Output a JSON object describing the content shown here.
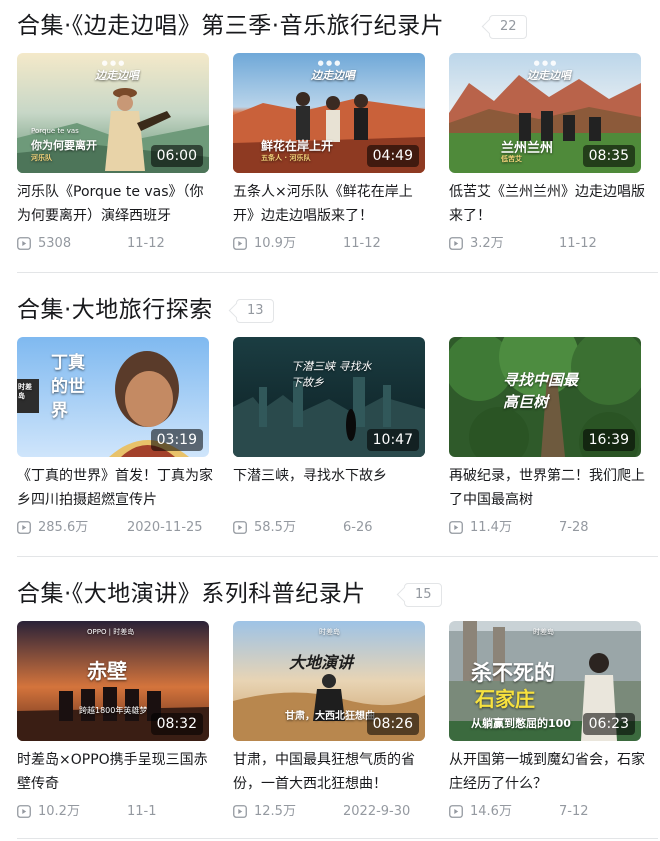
{
  "sections": [
    {
      "title": "合集·《边走边唱》第三季·音乐旅行纪录片",
      "count": "22",
      "cards": [
        {
          "title": "河乐队《Porque te vas》（你为何要离开）演绎西班牙",
          "duration": "06:00",
          "views": "5308",
          "date": "11-12",
          "overlay_main": "你为何要离开",
          "overlay_sub": "河乐队",
          "overlay_top": "Porque te vas",
          "logo": "边走边唱"
        },
        {
          "title": "五条人×河乐队《鲜花在岸上开》边走边唱版来了！",
          "duration": "04:49",
          "views": "10.9万",
          "date": "11-12",
          "overlay_main": "鲜花在岸上开",
          "overlay_sub": "五条人 · 河乐队",
          "logo": "边走边唱"
        },
        {
          "title": "低苦艾《兰州兰州》边走边唱版来了！",
          "duration": "08:35",
          "views": "3.2万",
          "date": "11-12",
          "overlay_main": "兰州兰州",
          "overlay_sub": "低苦艾",
          "logo": "边走边唱"
        }
      ]
    },
    {
      "title": "合集·大地旅行探索",
      "count": "13",
      "cards": [
        {
          "title": "《丁真的世界》首发！丁真为家乡四川拍摄超燃宣传片",
          "duration": "03:19",
          "views": "285.6万",
          "date": "2020-11-25",
          "overlay_main": "丁真的世界",
          "badge": "时差岛"
        },
        {
          "title": "下潜三峡，寻找水下故乡",
          "duration": "10:47",
          "views": "58.5万",
          "date": "6-26",
          "overlay_main": "下潜三峡 寻找水下故乡"
        },
        {
          "title": "再破纪录，世界第二！我们爬上了中国最高树",
          "duration": "16:39",
          "views": "11.4万",
          "date": "7-28",
          "overlay_main": "寻找中国最高巨树"
        }
      ]
    },
    {
      "title": "合集·《大地演讲》系列科普纪录片",
      "count": "15",
      "cards": [
        {
          "title": "时差岛×OPPO携手呈现三国赤壁传奇",
          "duration": "08:32",
          "views": "10.2万",
          "date": "11-1",
          "overlay_main": "赤壁",
          "overlay_sub": "跨越1800年英雄梦",
          "logo": "OPPO | 时差岛"
        },
        {
          "title": "甘肃，中国最具狂想气质的省份，一首大西北狂想曲！",
          "duration": "08:26",
          "views": "12.5万",
          "date": "2022-9-30",
          "overlay_main": "大地演讲",
          "overlay_sub": "甘肃，大西北狂想曲",
          "logo": "时差岛"
        },
        {
          "title": "从开国第一城到魔幻省会，石家庄经历了什么？",
          "duration": "06:23",
          "views": "14.6万",
          "date": "7-12",
          "overlay_main": "杀不死的",
          "overlay_main2": "石家庄",
          "overlay_sub": "从躺赢到憋屈的100",
          "logo": "时差岛"
        }
      ]
    }
  ],
  "colors": {
    "text_primary": "#18191c",
    "text_secondary": "#9499a0",
    "divider": "#e3e5e7",
    "duration_bg": "rgba(0,0,0,0.55)"
  },
  "icons": {
    "play_count": "play-count-icon"
  }
}
